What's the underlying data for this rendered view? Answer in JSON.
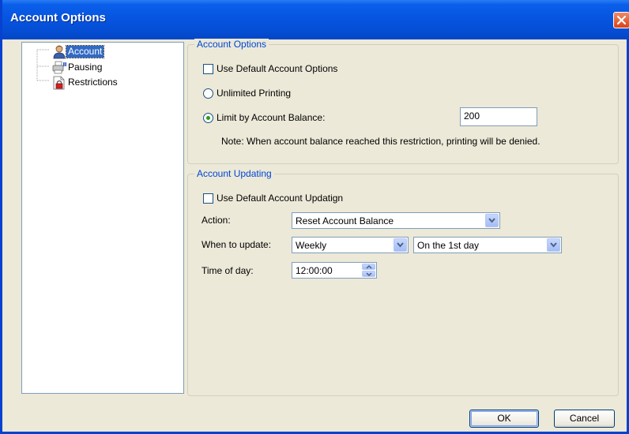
{
  "window": {
    "title": "Account Options"
  },
  "tree": {
    "items": [
      {
        "label": "Account",
        "icon": "user-icon",
        "selected": true
      },
      {
        "label": "Pausing",
        "icon": "printer-pause-icon",
        "selected": false
      },
      {
        "label": "Restrictions",
        "icon": "document-lock-icon",
        "selected": false
      }
    ]
  },
  "account_options": {
    "title": "Account Options",
    "use_default_label": "Use Default Account Options",
    "use_default_checked": false,
    "unlimited_label": "Unlimited Printing",
    "limit_label": "Limit by Account Balance:",
    "selected_mode": "limit",
    "limit_value": "200",
    "note": "Note: When account balance reached this restriction, printing will be denied."
  },
  "account_updating": {
    "title": "Account Updating",
    "use_default_label": "Use Default Account Updatign",
    "use_default_checked": false,
    "action_label": "Action:",
    "action_value": "Reset Account Balance",
    "when_label": "When to update:",
    "when_value": "Weekly",
    "day_value": "On the 1st day",
    "time_label": "Time of day:",
    "time_value": "12:00:00"
  },
  "buttons": {
    "ok": "OK",
    "cancel": "Cancel"
  },
  "colors": {
    "title_bar": "#0655e0",
    "group_title": "#0046d5",
    "selection": "#316ac5",
    "radio_dot": "#21a121"
  }
}
